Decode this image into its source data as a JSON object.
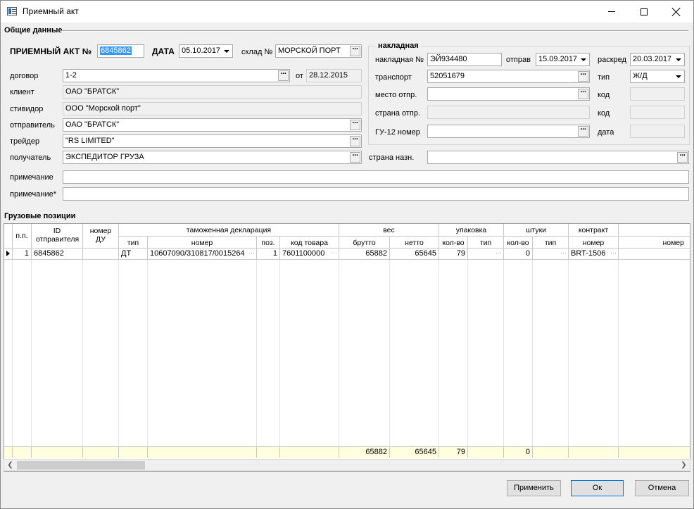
{
  "window": {
    "title": "Приемный акт"
  },
  "general": {
    "section_title": "Общие данные",
    "act_label": "ПРИЕМНЫЙ АКТ №",
    "act_number": "6845862",
    "date_label": "ДАТА",
    "date_value": "05.10.2017",
    "warehouse_label": "склад №",
    "warehouse_value": "МОРСКОЙ ПОРТ",
    "contract_label": "договор",
    "contract_value": "1-2",
    "from_label": "от",
    "from_value": "28.12.2015",
    "client_label": "клиент",
    "client_value": "ОАО \"БРАТСК\"",
    "stevedore_label": "стивидор",
    "stevedore_value": "ООО \"Морской порт\"",
    "sender_label": "отправитель",
    "sender_value": "ОАО \"БРАТСК\"",
    "trader_label": "трейдер",
    "trader_value": "\"RS LIMITED\"",
    "receiver_label": "получатель",
    "receiver_value": "ЭКСПЕДИТОР ГРУЗА",
    "dest_country_label": "страна назн.",
    "dest_country_value": "",
    "note_label": "примечание",
    "note_value": "",
    "note2_label": "примечание*",
    "note2_value": ""
  },
  "waybill": {
    "group_title": "накладная",
    "number_label": "накладная №",
    "number_value": "ЭЙ934480",
    "sent_label": "отправ",
    "sent_value": "15.09.2017",
    "unload_label": "раскред",
    "unload_value": "20.03.2017",
    "transport_label": "транспорт",
    "transport_value": "52051679",
    "type_label": "тип",
    "type_value": "Ж/Д",
    "origin_label": "место отпр.",
    "origin_value": "",
    "code_label": "код",
    "origin_country_label": "страна отпр.",
    "code2_label": "код",
    "gu12_label": "ГУ-12 номер",
    "gu12_value": "",
    "date_label": "дата"
  },
  "cargo": {
    "section_title": "Грузовые позиции",
    "headers": {
      "pp": "п.п.",
      "sender_id": "ID отправителя",
      "du": "номер ДУ",
      "customs": "таможенная декларация",
      "customs_type": "тип",
      "customs_number": "номер",
      "customs_pos": "поз.",
      "customs_code": "код товара",
      "weight": "вес",
      "gross": "брутто",
      "net": "нетто",
      "pack": "упаковка",
      "pack_qty": "кол-во",
      "pack_type": "тип",
      "pieces": "штуки",
      "pieces_qty": "кол-во",
      "pieces_type": "тип",
      "contract": "контракт",
      "contract_number": "номер",
      "number": "номер"
    },
    "rows": [
      {
        "pp": "1",
        "sender_id": "6845862",
        "du": "",
        "customs_type": "ДТ",
        "customs_number": "10607090/310817/0015264",
        "customs_pos": "1",
        "customs_code": "7601100000",
        "gross": "65882",
        "net": "65645",
        "pack_qty": "79",
        "pack_type": "",
        "pieces_qty": "0",
        "pieces_type": "",
        "contract_number": "BRT-1506",
        "number": ""
      }
    ],
    "totals": {
      "gross": "65882",
      "net": "65645",
      "pack_qty": "79",
      "pieces_qty": "0"
    }
  },
  "buttons": {
    "apply": "Применить",
    "ok": "Ок",
    "cancel": "Отмена"
  }
}
